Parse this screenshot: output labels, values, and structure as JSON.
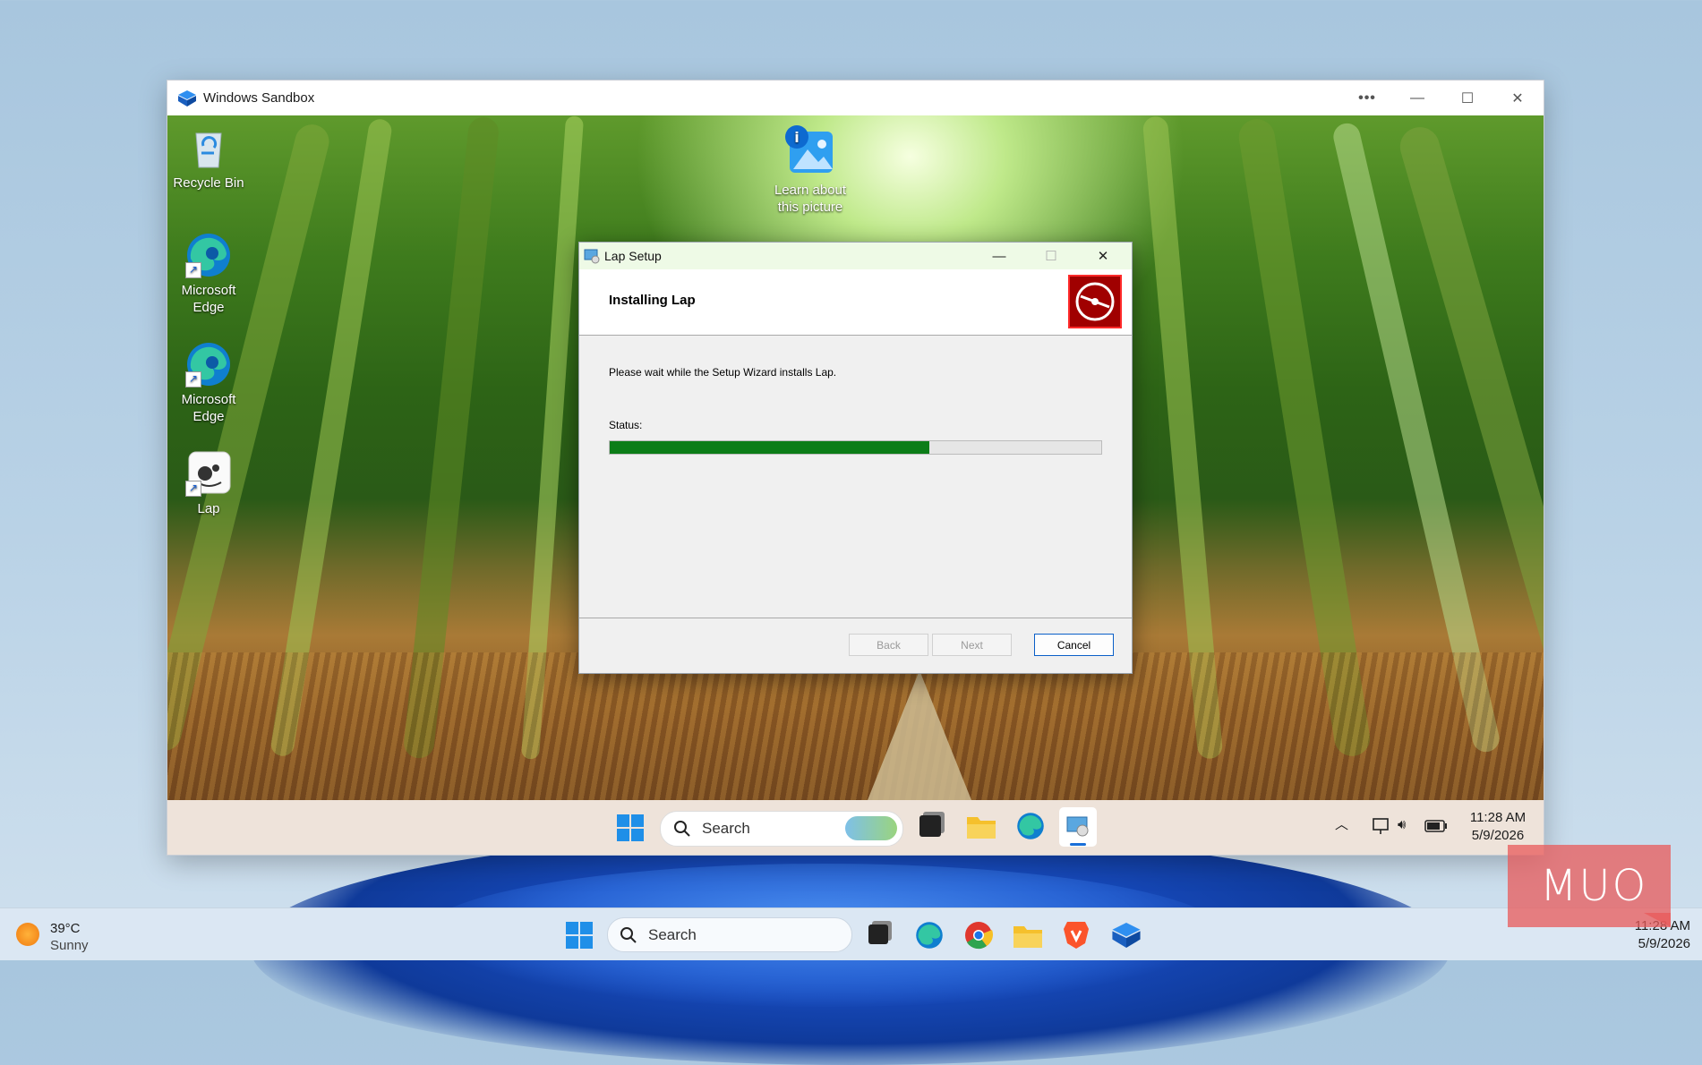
{
  "sandbox": {
    "title": "Windows Sandbox",
    "more_label": "•••",
    "minimize_label": "—",
    "maximize_label": "☐",
    "close_label": "✕"
  },
  "desktop_icons": [
    {
      "label": "Recycle Bin"
    },
    {
      "label": "Microsoft Edge"
    },
    {
      "label": "Microsoft Edge"
    },
    {
      "label": "Lap"
    },
    {
      "label": "Learn about this picture"
    }
  ],
  "setup": {
    "title": "Lap Setup",
    "heading": "Installing Lap",
    "message": "Please wait while the Setup Wizard installs Lap.",
    "status_label": "Status:",
    "progress_fraction": 0.65,
    "buttons": {
      "back": "Back",
      "next": "Next",
      "cancel": "Cancel"
    },
    "minimize_label": "—",
    "maximize_label": "☐",
    "close_label": "✕"
  },
  "inner_taskbar": {
    "search_placeholder": "Search",
    "time": "11:28 AM",
    "date": "5/9/2026"
  },
  "host_taskbar": {
    "weather_temp": "39°C",
    "weather_desc": "Sunny",
    "search_placeholder": "Search",
    "time": "11:28 AM",
    "date": "5/9/2026"
  },
  "watermark": "MUO",
  "colors": {
    "progress": "#0c7d18",
    "accent": "#0a5fc8",
    "logo_red": "#a00000"
  }
}
